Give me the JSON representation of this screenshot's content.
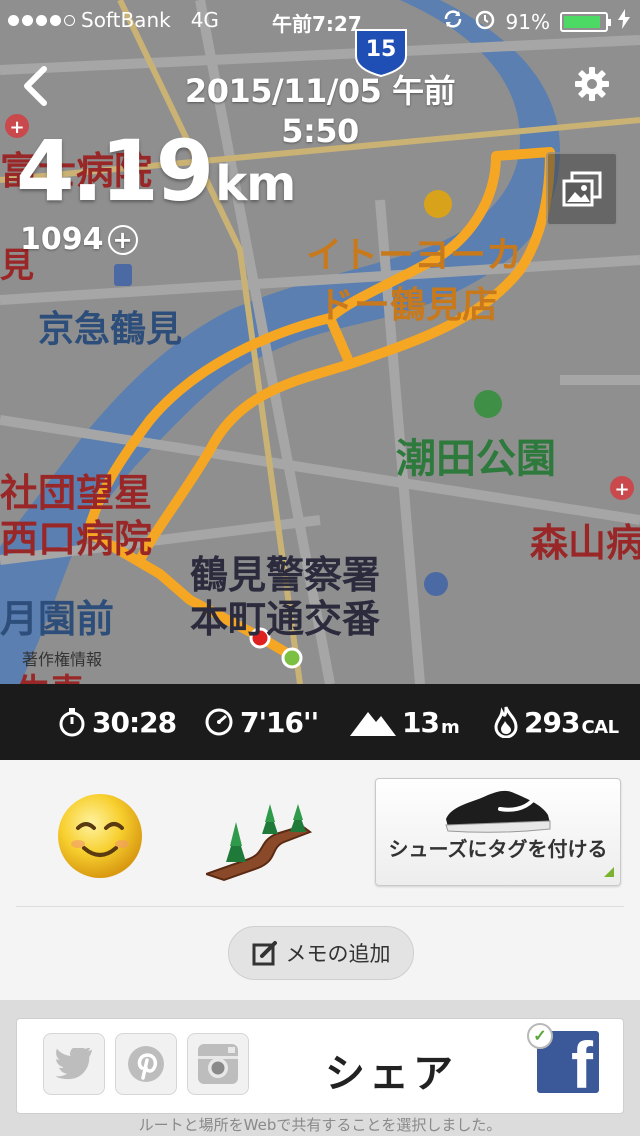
{
  "status_bar": {
    "carrier": "SoftBank",
    "network": "4G",
    "time": "午前7:27",
    "battery_percent": "91%",
    "battery_level": 0.91,
    "battery_color": "#4cd964"
  },
  "header": {
    "back_icon": "chevron-left-icon",
    "title": "2015/11/05  午前5:50",
    "settings_icon": "gear-icon"
  },
  "run": {
    "distance_value": "4.19",
    "distance_unit": "km",
    "fuel": "1094",
    "fuel_icon": "plus-circle-icon"
  },
  "map": {
    "route_color": "#f5a623",
    "start_color": "#7bc043",
    "end_color": "#e02020",
    "copyright": "著作権情報",
    "highway_shield": "15",
    "photo_icon": "photo-gallery-icon",
    "labels": {
      "keikyu": "京急鶴見",
      "itoyokado_1": "イトーヨーカ",
      "itoyokado_2": "ドー鶴見店",
      "ushioda": "潮田公園",
      "police_1": "鶴見警察署",
      "police_2": "本町通交番",
      "hospital_a": "富士病院",
      "hospital_a2": "見",
      "shadan_1": "社団望星",
      "shadan_2": "西口病院",
      "moriyama": "森山病",
      "tsukizono": "月園前",
      "bottom": "生麦"
    }
  },
  "stats": {
    "duration": "30:28",
    "duration_icon": "stopwatch-icon",
    "pace": "7'16''",
    "pace_icon": "speedometer-icon",
    "elevation": "13",
    "elevation_unit": "m",
    "elevation_icon": "mountain-icon",
    "calories": "293",
    "calories_unit": "CAL",
    "calories_icon": "flame-icon"
  },
  "details": {
    "mood_icon": "smiling-face-icon",
    "terrain_icon": "trail-icon",
    "shoe_icon": "running-shoe-icon",
    "shoe_label": "シューズにタグを付ける",
    "memo_icon": "edit-icon",
    "memo_label": "メモの追加"
  },
  "share": {
    "label": "シェア",
    "twitter_icon": "twitter-icon",
    "pinterest_icon": "pinterest-icon",
    "instagram_icon": "instagram-icon",
    "facebook_icon": "facebook-icon",
    "facebook_letter": "f",
    "checkmark_icon": "checkmark-icon",
    "check_glyph": "✓",
    "note": "ルートと場所をWebで共有することを選択しました。"
  }
}
